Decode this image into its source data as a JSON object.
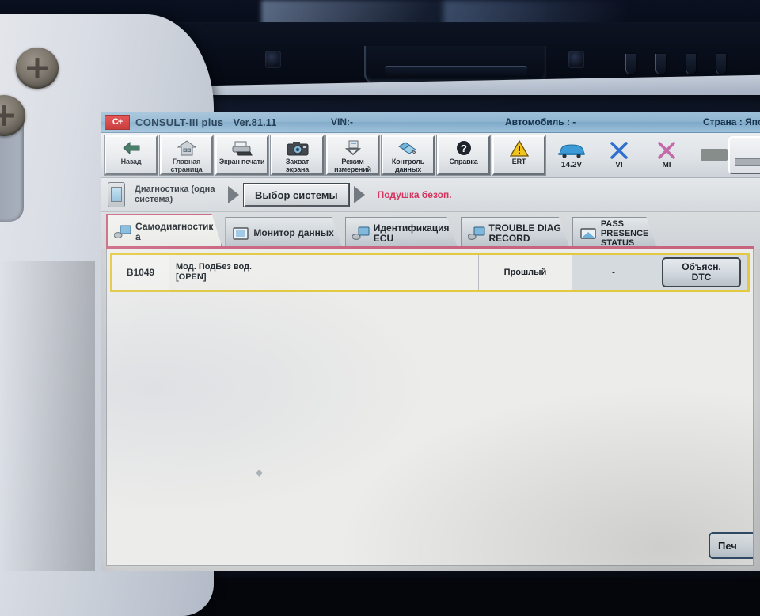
{
  "app": {
    "logo_text": "C+",
    "title": "CONSULT-III plus",
    "version": "Ver.81.11",
    "vin": "VIN:-",
    "vehicle": "Автомобиль : -",
    "country": "Страна : Япо"
  },
  "toolbar": {
    "buttons": [
      {
        "label": "Назад",
        "icon": "back-arrow-icon"
      },
      {
        "label": "Главная\nстраница",
        "line1": "Главная",
        "line2": "страница",
        "icon": "home-icon"
      },
      {
        "label": "Экран печати",
        "line1": "Экран печати",
        "line2": "",
        "icon": "printer-icon"
      },
      {
        "label": "Захват\nэкрана",
        "line1": "Захват",
        "line2": "экрана",
        "icon": "camera-icon"
      },
      {
        "label": "Режим\nизмерений",
        "line1": "Режим",
        "line2": "измерений",
        "icon": "measurement-icon"
      },
      {
        "label": "Контроль\nданных",
        "line1": "Контроль",
        "line2": "данных",
        "icon": "data-control-icon"
      },
      {
        "label": "Справка",
        "line1": "Справка",
        "line2": "",
        "icon": "help-icon"
      },
      {
        "label": "ERT",
        "line1": "ERT",
        "line2": "",
        "icon": "warning-icon"
      }
    ],
    "status": [
      {
        "label": "14.2V",
        "icon": "car-icon"
      },
      {
        "label": "VI",
        "icon": "cross-blue-icon"
      },
      {
        "label": "MI",
        "icon": "cross-pink-icon"
      },
      {
        "label": "",
        "icon": "battery-icon"
      }
    ]
  },
  "breadcrumb": {
    "icon": "device-icon",
    "step1": "Диагностика (одна система)",
    "step2": "Выбор системы",
    "current": "Подушка безоп."
  },
  "tabs": [
    {
      "label": "Самодиагностика",
      "line1": "Самодиагностик",
      "line2": "а",
      "icon": "self-diagnostic-icon",
      "active": true
    },
    {
      "label": "Монитор данных",
      "line1": "Монитор данных",
      "line2": "",
      "icon": "monitor-icon",
      "active": false
    },
    {
      "label": "Идентификация ECU",
      "line1": "Идентификация",
      "line2": "ECU",
      "icon": "ecu-id-icon",
      "active": false
    },
    {
      "label": "TROUBLE DIAG RECORD",
      "line1": "TROUBLE DIAG",
      "line2": "RECORD",
      "icon": "trouble-diag-icon",
      "active": false
    },
    {
      "label": "PASS PRESENCE STATUS",
      "line1": "PASS",
      "line2": "PRESENCE",
      "line3": "STATUS",
      "icon": "pass-presence-icon",
      "active": false
    }
  ],
  "dtc_table": {
    "rows": [
      {
        "code": "B1049",
        "desc_line1": "Мод. ПодБез вод.",
        "desc_line2": "[OPEN]",
        "status": "Прошлый",
        "extra": "-",
        "button_line1": "Объясн.",
        "button_line2": "DTC"
      }
    ]
  },
  "footer": {
    "print_button": "Печ"
  },
  "colors": {
    "header_blue": "#8db4d0",
    "accent_red": "#d4315c",
    "row_highlight_yellow": "#e3c93f",
    "logo_red": "#e23b3b"
  }
}
